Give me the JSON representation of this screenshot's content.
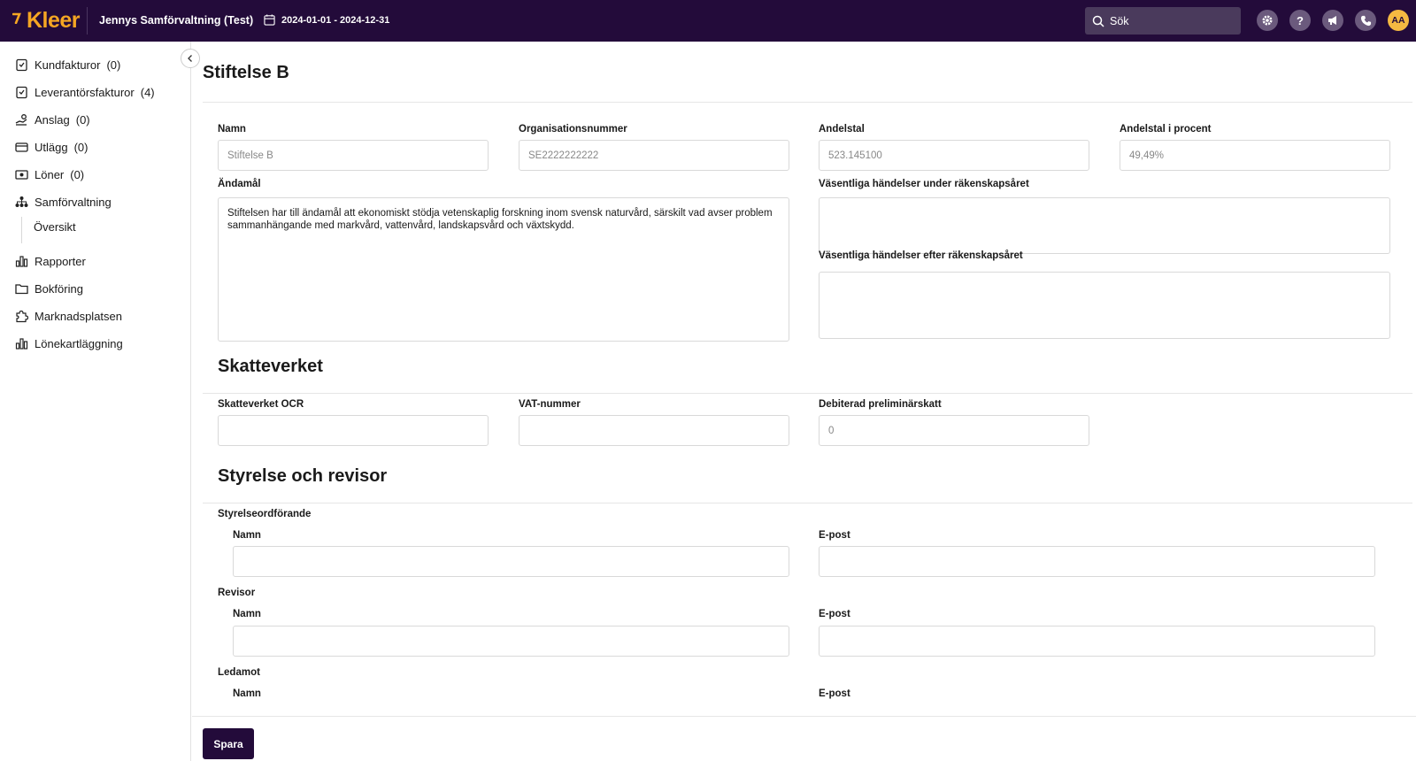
{
  "topbar": {
    "logo": "Kleer",
    "company": "Jennys Samförvaltning (Test)",
    "period": "2024-01-01 - 2024-12-31",
    "search_placeholder": "Sök",
    "avatar_initials": "AA",
    "colors": {
      "background": "#230b3a",
      "accent": "#f5a623"
    }
  },
  "sidebar": {
    "items": [
      {
        "label": "Kundfakturor",
        "count": "(0)",
        "icon": "customer-invoice-icon"
      },
      {
        "label": "Leverantörsfakturor",
        "count": "(4)",
        "icon": "supplier-invoice-icon"
      },
      {
        "label": "Anslag",
        "count": "(0)",
        "icon": "grant-icon"
      },
      {
        "label": "Utlägg",
        "count": "(0)",
        "icon": "expense-card-icon"
      },
      {
        "label": "Löner",
        "count": "(0)",
        "icon": "salary-icon"
      },
      {
        "label": "Samförvaltning",
        "count": "",
        "icon": "org-chart-icon"
      },
      {
        "label": "Rapporter",
        "count": "",
        "icon": "bar-chart-icon"
      },
      {
        "label": "Bokföring",
        "count": "",
        "icon": "folder-icon"
      },
      {
        "label": "Marknadsplatsen",
        "count": "",
        "icon": "puzzle-icon"
      },
      {
        "label": "Lönekartläggning",
        "count": "",
        "icon": "bar-chart-icon"
      }
    ],
    "subitem": "Översikt"
  },
  "page": {
    "title": "Stiftelse B",
    "fields": {
      "namn": {
        "label": "Namn",
        "value": "Stiftelse B"
      },
      "orgnr": {
        "label": "Organisationsnummer",
        "value": "SE2222222222"
      },
      "andelstal": {
        "label": "Andelstal",
        "value": "523.145100"
      },
      "andelstal_procent": {
        "label": "Andelstal i procent",
        "value": "49,49%"
      },
      "andamal": {
        "label": "Ändamål",
        "value": "Stiftelsen har till ändamål att ekonomiskt stödja vetenskaplig forskning inom svensk naturvård, särskilt vad avser problem sammanhängande med markvård, vattenvård, landskapsvård och växtskydd."
      },
      "vasentliga_under": {
        "label": "Väsentliga händelser under räkenskapsåret",
        "value": ""
      },
      "vasentliga_efter": {
        "label": "Väsentliga händelser efter räkenskapsåret",
        "value": ""
      }
    },
    "skatteverket": {
      "title": "Skatteverket",
      "ocr": {
        "label": "Skatteverket OCR",
        "value": ""
      },
      "vat": {
        "label": "VAT-nummer",
        "value": ""
      },
      "prelskatt": {
        "label": "Debiterad preliminärskatt",
        "value": "0"
      }
    },
    "styrelse": {
      "title": "Styrelse och revisor",
      "groups": [
        {
          "title": "Styrelseordförande",
          "name_label": "Namn",
          "email_label": "E-post"
        },
        {
          "title": "Revisor",
          "name_label": "Namn",
          "email_label": "E-post"
        },
        {
          "title": "Ledamot",
          "name_label": "Namn",
          "email_label": "E-post"
        }
      ]
    },
    "save_label": "Spara"
  }
}
